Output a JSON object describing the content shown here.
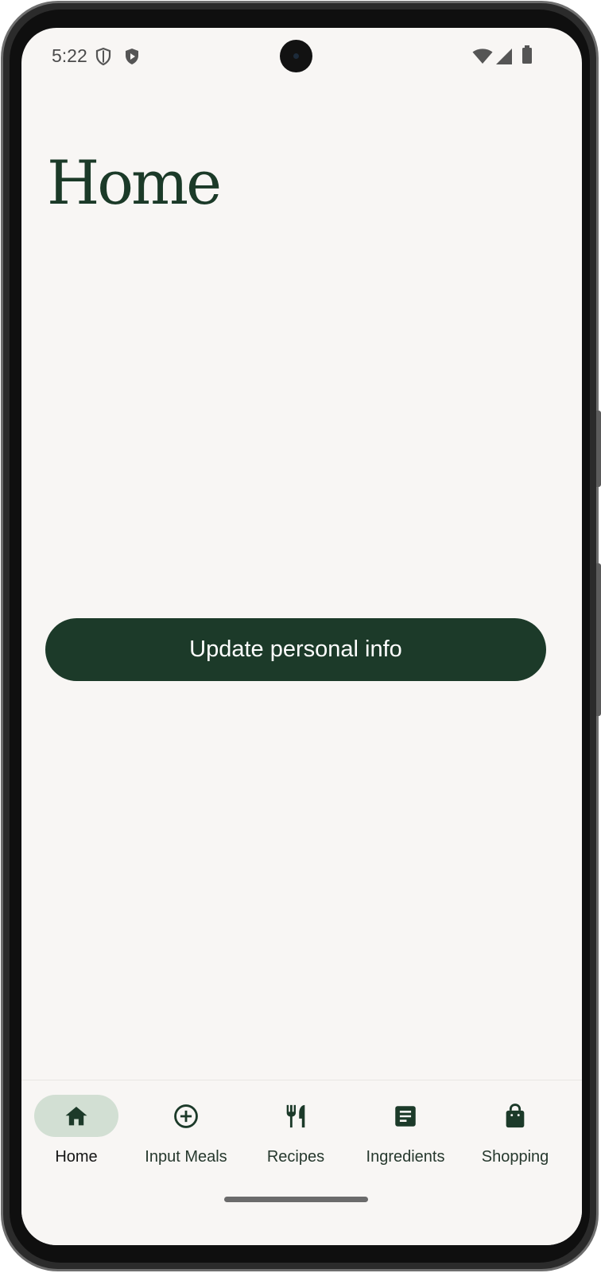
{
  "status_bar": {
    "time": "5:22",
    "left_icons": [
      "shield-outline-icon",
      "shield-play-icon"
    ],
    "right_icons": [
      "wifi-icon",
      "cell-signal-icon",
      "battery-icon"
    ]
  },
  "page": {
    "title": "Home"
  },
  "actions": {
    "update_button_label": "Update personal info"
  },
  "bottom_nav": {
    "active": "Home",
    "items": [
      {
        "label": "Home",
        "icon": "home-icon"
      },
      {
        "label": "Input Meals",
        "icon": "add-circle-icon"
      },
      {
        "label": "Recipes",
        "icon": "fork-knife-icon"
      },
      {
        "label": "Ingredients",
        "icon": "list-document-icon"
      },
      {
        "label": "Shopping",
        "icon": "shopping-bag-icon"
      }
    ]
  },
  "colors": {
    "brand_dark_green": "#1c3a29",
    "active_pill": "#d2dfd3",
    "screen_background": "#f8f6f4"
  }
}
